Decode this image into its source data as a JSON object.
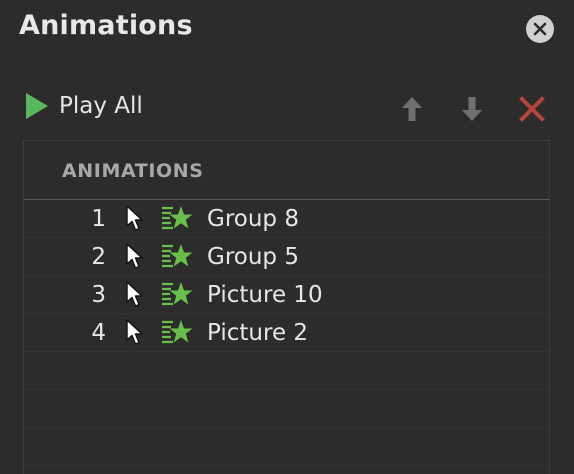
{
  "pane": {
    "title": "Animations",
    "close_icon": "close-circle-icon"
  },
  "toolbar": {
    "play_all_label": "Play All",
    "play_icon": "play-icon",
    "move_up_icon": "arrow-up-icon",
    "move_down_icon": "arrow-down-icon",
    "delete_icon": "delete-x-icon"
  },
  "list": {
    "header": "ANIMATIONS",
    "items": [
      {
        "order": "1",
        "name": "Group 8",
        "trigger": "on-click",
        "effect": "fly-in"
      },
      {
        "order": "2",
        "name": "Group 5",
        "trigger": "on-click",
        "effect": "fly-in"
      },
      {
        "order": "3",
        "name": "Picture 10",
        "trigger": "on-click",
        "effect": "fly-in"
      },
      {
        "order": "4",
        "name": "Picture 2",
        "trigger": "on-click",
        "effect": "fly-in"
      }
    ]
  },
  "colors": {
    "background": "#2c2c2c",
    "play_green": "#5cb85c",
    "effect_green": "#6abf4b",
    "delete_red": "#b5453f",
    "disabled_arrow": "#6f6f6f"
  }
}
